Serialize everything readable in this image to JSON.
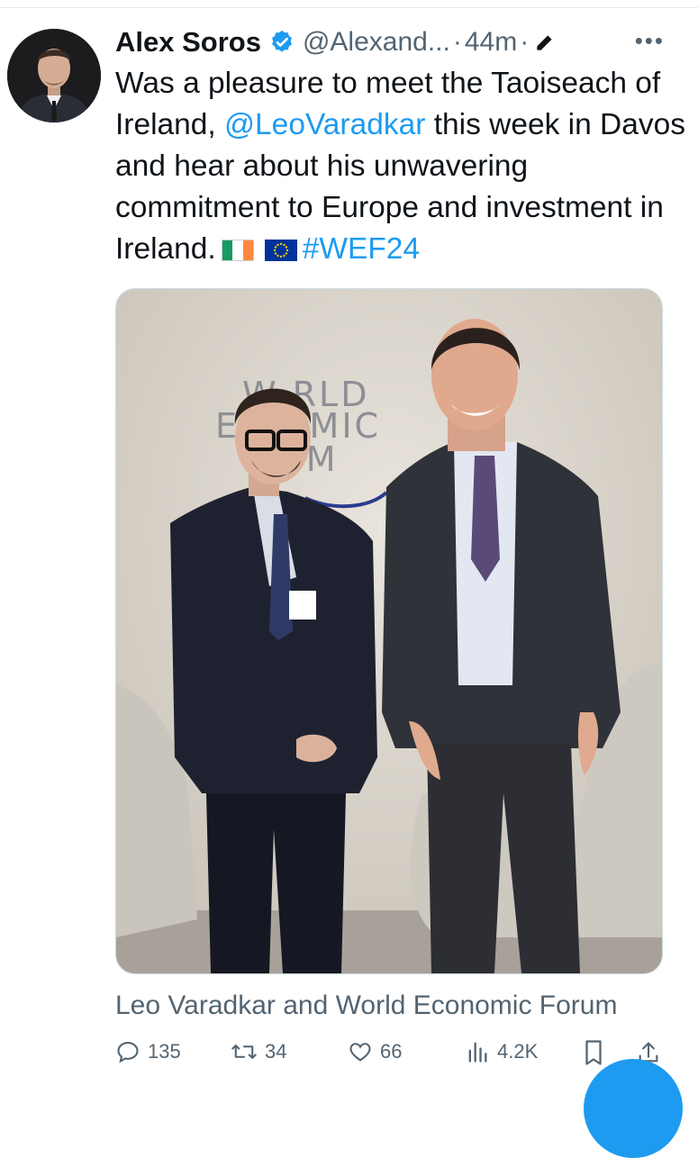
{
  "tweet": {
    "author_name": "Alex Soros",
    "handle": "@Alexand...",
    "separator": "·",
    "time": "44m",
    "text_part1": "Was a pleasure to meet the Taoiseach of Ireland, ",
    "mention": "@LeoVaradkar",
    "text_part2": " this week in Davos and hear about his unwavering commitment to Europe and investment in Ireland.",
    "hashtag": "#WEF24"
  },
  "media": {
    "caption": "Leo Varadkar and World Economic Forum",
    "backdrop_text_lines": [
      "W RLD",
      "EC OMIC",
      "F UM"
    ]
  },
  "actions": {
    "replies": "135",
    "retweets": "34",
    "likes": "66",
    "views": "4.2K"
  },
  "colors": {
    "link": "#1d9bf0",
    "secondary_text": "#536471",
    "primary_text": "#0f1419"
  }
}
